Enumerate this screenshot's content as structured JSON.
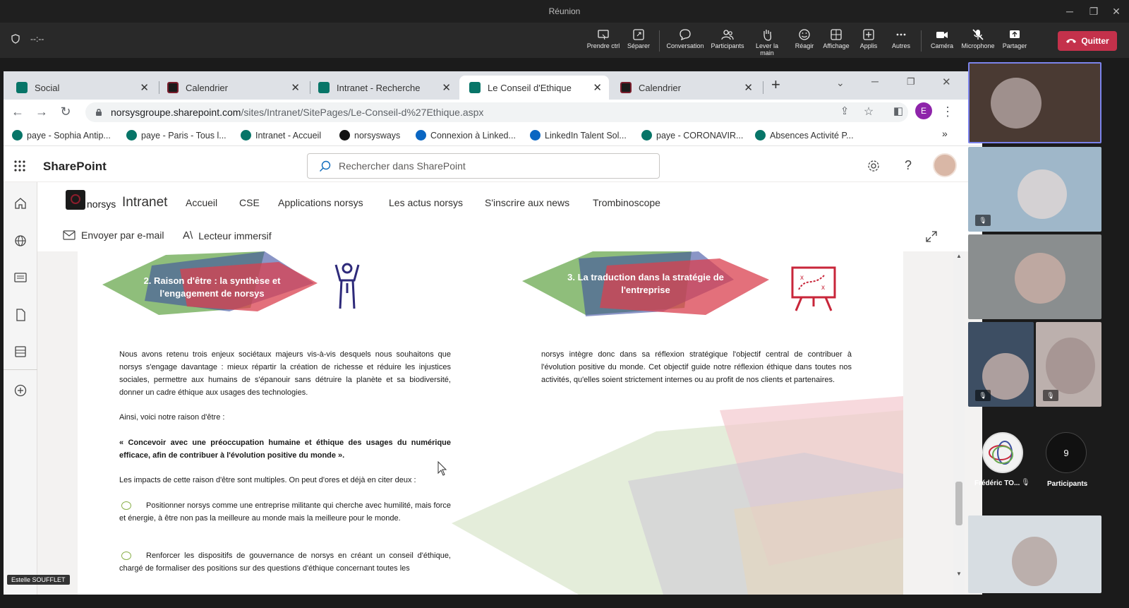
{
  "teams": {
    "window_title": "Réunion",
    "timer": "--:--",
    "toolbar": [
      {
        "label": "Prendre ctrl",
        "icon": "take-control-icon"
      },
      {
        "label": "Séparer",
        "icon": "popout-icon"
      },
      {
        "label": "Conversation",
        "icon": "chat-icon"
      },
      {
        "label": "Participants",
        "icon": "people-icon"
      },
      {
        "label": "Lever la main",
        "icon": "raise-hand-icon"
      },
      {
        "label": "Réagir",
        "icon": "smiley-icon"
      },
      {
        "label": "Affichage",
        "icon": "grid-icon"
      },
      {
        "label": "Applis",
        "icon": "apps-plus-icon"
      },
      {
        "label": "Autres",
        "icon": "more-icon"
      },
      {
        "label": "Caméra",
        "icon": "camera-icon"
      },
      {
        "label": "Microphone",
        "icon": "microphone-off-icon"
      },
      {
        "label": "Partager",
        "icon": "share-icon"
      }
    ],
    "quit_label": "Quitter",
    "presenter_name": "Estelle SOUFFLET",
    "participant_avatar_name": "Frédéric TO...",
    "participants_count": "9",
    "participants_label": "Participants"
  },
  "browser": {
    "tabs": [
      {
        "title": "Social"
      },
      {
        "title": "Calendrier"
      },
      {
        "title": "Intranet - Recherche"
      },
      {
        "title": "Le Conseil d'Ethique"
      },
      {
        "title": "Calendrier"
      }
    ],
    "url_host": "norsysgroupe.sharepoint.com",
    "url_path": "/sites/Intranet/SitePages/Le-Conseil-d%27Ethique.aspx",
    "profile_initial": "E",
    "bookmarks": [
      "paye - Sophia Antip...",
      "paye - Paris - Tous l...",
      "Intranet - Accueil",
      "norsysways",
      "Connexion à Linked...",
      "LinkedIn Talent Sol...",
      "paye - CORONAVIR...",
      "Absences Activité P..."
    ],
    "more_bookmarks": "»"
  },
  "sharepoint": {
    "app_name": "SharePoint",
    "search_placeholder": "Rechercher dans SharePoint",
    "logo_text": "norsys",
    "site_title": "Intranet",
    "nav": [
      "Accueil",
      "CSE",
      "Applications norsys",
      "Les actus norsys",
      "S'inscrire aux news",
      "Trombinoscope"
    ],
    "cmd_email": "Envoyer par e-mail",
    "cmd_reader": "Lecteur immersif"
  },
  "document": {
    "heading2": "2. Raison d'être : la synthèse et l'engagement de norsys",
    "heading3": "3. La traduction dans la stratégie de l'entreprise",
    "para1": "Nous avons retenu trois enjeux sociétaux majeurs vis-à-vis desquels nous souhaitons que norsys s'engage davantage : mieux répartir la création de richesse et réduire les injustices sociales, permettre aux humains de s'épanouir sans détruire la planète et sa biodiversité, donner un cadre éthique aux usages des technologies.",
    "para2": "Ainsi, voici notre raison d'être :",
    "quote": "« Concevoir avec une préoccupation humaine et éthique des usages du numérique efficace, afin de contribuer à l'évolution positive du monde ».",
    "para3": "Les impacts de cette raison d'être sont multiples. On peut d'ores et déjà en citer deux :",
    "bullet1": "Positionner norsys comme une entreprise militante qui cherche avec humilité, mais force et énergie, à être non pas la meilleure au monde mais la meilleure pour le monde.",
    "bullet2": "Renforcer les dispositifs de gouvernance de norsys en créant un conseil d'éthique, chargé de formaliser des positions sur des questions d'éthique concernant toutes les",
    "right_para": "norsys intègre donc dans sa réflexion stratégique l'objectif central de contribuer à l'évolution positive du monde. Cet objectif guide notre réflexion éthique dans toutes nos activités, qu'elles soient strictement internes ou au profit de nos clients et partenaires."
  }
}
